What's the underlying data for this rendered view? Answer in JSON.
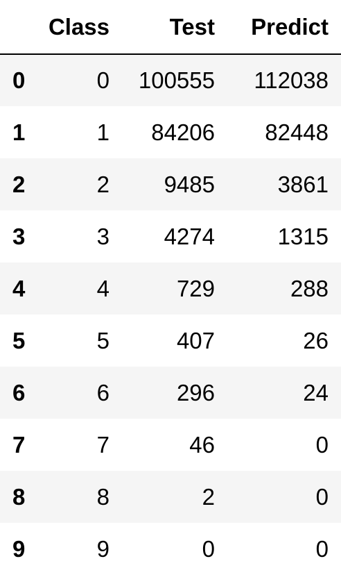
{
  "table": {
    "headers": [
      "",
      "Class",
      "Test",
      "Predict"
    ],
    "rows": [
      {
        "index": "0",
        "class": "0",
        "test": "100555",
        "predict": "112038"
      },
      {
        "index": "1",
        "class": "1",
        "test": "84206",
        "predict": "82448"
      },
      {
        "index": "2",
        "class": "2",
        "test": "9485",
        "predict": "3861"
      },
      {
        "index": "3",
        "class": "3",
        "test": "4274",
        "predict": "1315"
      },
      {
        "index": "4",
        "class": "4",
        "test": "729",
        "predict": "288"
      },
      {
        "index": "5",
        "class": "5",
        "test": "407",
        "predict": "26"
      },
      {
        "index": "6",
        "class": "6",
        "test": "296",
        "predict": "24"
      },
      {
        "index": "7",
        "class": "7",
        "test": "46",
        "predict": "0"
      },
      {
        "index": "8",
        "class": "8",
        "test": "2",
        "predict": "0"
      },
      {
        "index": "9",
        "class": "9",
        "test": "0",
        "predict": "0"
      }
    ]
  },
  "colors": {
    "stripe": "#f5f5f5",
    "background": "#ffffff",
    "text": "#000000"
  }
}
